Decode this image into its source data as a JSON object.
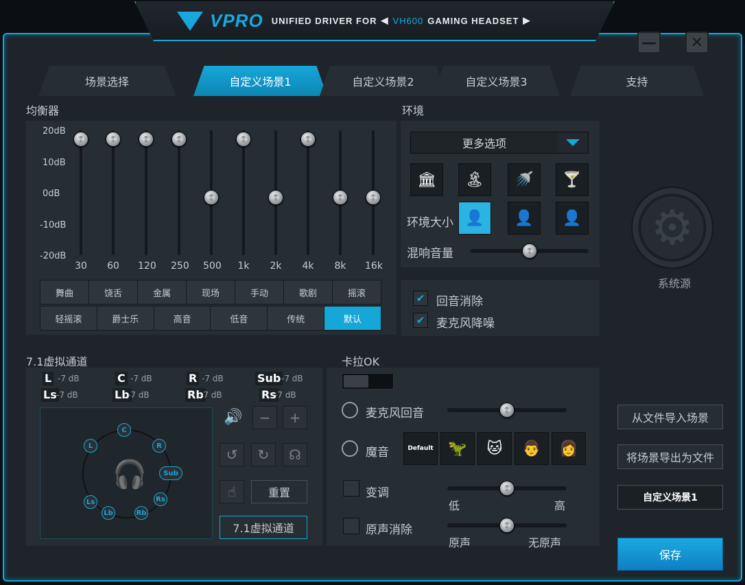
{
  "header": {
    "brand": "VPRO",
    "subtitle_prefix": "UNIFIED DRIVER FOR",
    "model": "VH600",
    "subtitle_suffix": "GAMING HEADSET",
    "prev_icon": "◀",
    "next_icon": "▶"
  },
  "window": {
    "minimize": "—",
    "close": "✕"
  },
  "tabs": [
    "场景选择",
    "自定义场景1",
    "自定义场景2",
    "自定义场景3",
    "支持"
  ],
  "active_tab": "自定义场景1",
  "equalizer": {
    "title": "均衡器",
    "db_labels": [
      "20dB",
      "10dB",
      "0dB",
      "-10dB",
      "-20dB"
    ],
    "bands": [
      "30",
      "60",
      "120",
      "250",
      "500",
      "1k",
      "2k",
      "4k",
      "8k",
      "16k"
    ],
    "band_values_db": [
      20,
      20,
      20,
      20,
      0,
      20,
      0,
      20,
      0,
      0
    ],
    "presets_row1": [
      "舞曲",
      "饶舌",
      "金属",
      "现场",
      "手动",
      "歌剧",
      "摇滚"
    ],
    "presets_row2": [
      "轻摇滚",
      "爵士乐",
      "高音",
      "低音",
      "传统",
      "默认"
    ],
    "active_preset": "默认"
  },
  "environment": {
    "title": "环境",
    "dropdown": "更多选项",
    "env_icons": [
      "bank-icon",
      "beach-icon",
      "shower-icon",
      "cocktail-icon"
    ],
    "size_label": "环境大小",
    "reverb_label": "混响音量",
    "reverb_level": 0.5
  },
  "options": {
    "echo_cancel": "回音消除",
    "mic_noise": "麦克风降噪"
  },
  "system_source": "系统源",
  "virtual": {
    "title": "7.1虚拟通道",
    "channels": [
      {
        "name": "L",
        "val": "-7 dB"
      },
      {
        "name": "C",
        "val": "-7 dB"
      },
      {
        "name": "R",
        "val": "-7 dB"
      },
      {
        "name": "Sub",
        "val": "-7 dB"
      },
      {
        "name": "Ls",
        "val": "-7 dB"
      },
      {
        "name": "Lb",
        "val": "-7 dB"
      },
      {
        "name": "Rb",
        "val": "-7 dB"
      },
      {
        "name": "Rs",
        "val": "-7 dB"
      }
    ],
    "speakers": [
      "C",
      "L",
      "R",
      "Sub",
      "Ls",
      "Rs",
      "Lb",
      "Rb"
    ],
    "reset": "重置",
    "virtual_btn": "7.1虚拟通道"
  },
  "karaoke": {
    "title": "卡拉OK",
    "mic_echo": "麦克风回音",
    "magic": "魔音",
    "magic_default": "Default",
    "pitch": "变调",
    "pitch_low": "低",
    "pitch_high": "高",
    "vocal_remove": "原声消除",
    "vocal_left": "原声",
    "vocal_right": "无原声",
    "mic_echo_level": 0.5,
    "pitch_level": 0.5,
    "vocal_level": 0.5
  },
  "side": {
    "import": "从文件导入场景",
    "export": "将场景导出为文件",
    "scene_name": "自定义场景1",
    "save": "保存"
  }
}
